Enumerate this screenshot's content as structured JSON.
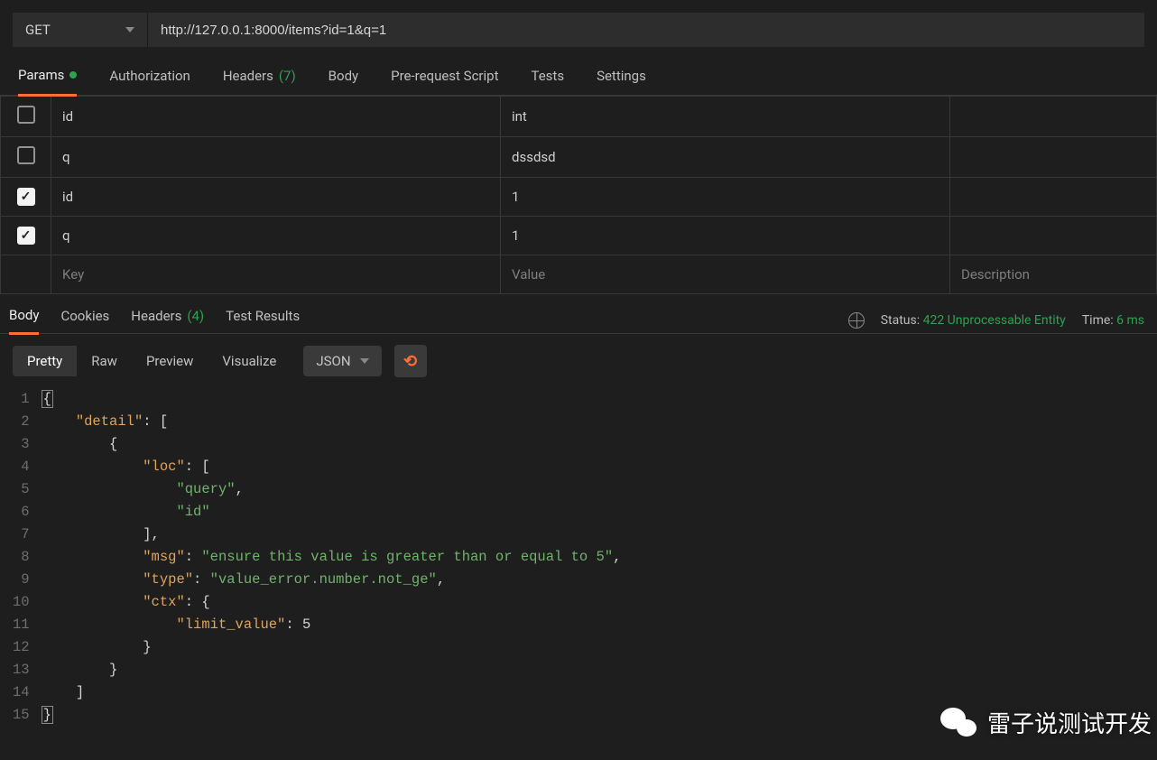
{
  "request": {
    "method": "GET",
    "url": "http://127.0.0.1:8000/items?id=1&q=1"
  },
  "request_tabs": {
    "params": "Params",
    "authorization": "Authorization",
    "headers": "Headers",
    "headers_count": "(7)",
    "body": "Body",
    "pre_request": "Pre-request Script",
    "tests": "Tests",
    "settings": "Settings"
  },
  "params_rows": [
    {
      "checked": false,
      "key": "id",
      "value": "int"
    },
    {
      "checked": false,
      "key": "q",
      "value": "dssdsd"
    },
    {
      "checked": true,
      "key": "id",
      "value": "1"
    },
    {
      "checked": true,
      "key": "q",
      "value": "1"
    }
  ],
  "params_placeholder": {
    "key": "Key",
    "value": "Value",
    "description": "Description"
  },
  "response_tabs": {
    "body": "Body",
    "cookies": "Cookies",
    "headers": "Headers",
    "headers_count": "(4)",
    "test_results": "Test Results"
  },
  "response_meta": {
    "status_label": "Status:",
    "status_value": "422 Unprocessable Entity",
    "time_label": "Time:",
    "time_value": "6 ms"
  },
  "view_modes": {
    "pretty": "Pretty",
    "raw": "Raw",
    "preview": "Preview",
    "visualize": "Visualize",
    "format": "JSON"
  },
  "response_body": {
    "detail_key": "\"detail\"",
    "loc_key": "\"loc\"",
    "loc_v0": "\"query\"",
    "loc_v1": "\"id\"",
    "msg_key": "\"msg\"",
    "msg_val": "\"ensure this value is greater than or equal to 5\"",
    "type_key": "\"type\"",
    "type_val": "\"value_error.number.not_ge\"",
    "ctx_key": "\"ctx\"",
    "limit_key": "\"limit_value\"",
    "limit_val": "5"
  },
  "line_numbers": [
    "1",
    "2",
    "3",
    "4",
    "5",
    "6",
    "7",
    "8",
    "9",
    "10",
    "11",
    "12",
    "13",
    "14",
    "15"
  ],
  "watermark": "雷子说测试开发"
}
